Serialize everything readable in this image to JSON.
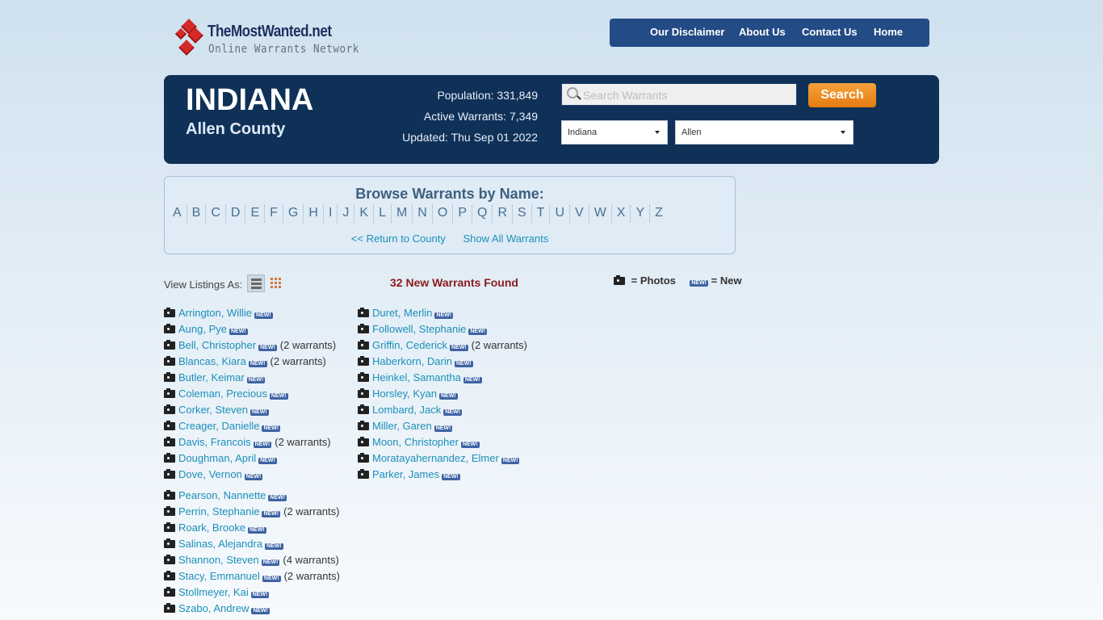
{
  "logo": {
    "title": "TheMostWanted.net",
    "tagline": "Online Warrants Network"
  },
  "nav": {
    "items": [
      "Our Disclaimer",
      "About Us",
      "Contact Us",
      "Home"
    ]
  },
  "banner": {
    "state": "INDIANA",
    "county": "Allen County",
    "population": "Population: 331,849",
    "active_warrants": "Active Warrants: 7,349",
    "updated": "Updated: Thu Sep 01 2022",
    "search_placeholder": "Search Warrants",
    "search_value": "",
    "search_button": "Search",
    "state_select": "Indiana",
    "county_select": "Allen"
  },
  "browse": {
    "title": "Browse Warrants by Name:",
    "letters": [
      "A",
      "B",
      "C",
      "D",
      "E",
      "F",
      "G",
      "H",
      "I",
      "J",
      "K",
      "L",
      "M",
      "N",
      "O",
      "P",
      "Q",
      "R",
      "S",
      "T",
      "U",
      "V",
      "W",
      "X",
      "Y",
      "Z"
    ],
    "return_link": "<< Return to County",
    "show_all_link": "Show All Warrants"
  },
  "listing": {
    "view_as_label": "View Listings As:",
    "found_text": "32 New Warrants Found",
    "legend_photos": "= Photos",
    "legend_new": "= New",
    "new_badge": "NEW!",
    "icons": {
      "photo": "camera-icon",
      "new": "new-badge-icon",
      "list_view": "list-view-icon",
      "grid_view": "grid-view-icon"
    }
  },
  "warrants": {
    "col1a": [
      {
        "name": "Arrington, Willie",
        "count": ""
      },
      {
        "name": "Aung, Pye",
        "count": ""
      },
      {
        "name": "Bell, Christopher",
        "count": "(2 warrants)"
      },
      {
        "name": "Blancas, Kiara",
        "count": "(2 warrants)"
      },
      {
        "name": "Butler, Keimar",
        "count": ""
      },
      {
        "name": "Coleman, Precious",
        "count": ""
      },
      {
        "name": "Corker, Steven",
        "count": ""
      },
      {
        "name": "Creager, Danielle",
        "count": ""
      },
      {
        "name": "Davis, Francois",
        "count": "(2 warrants)"
      },
      {
        "name": "Doughman, April",
        "count": ""
      },
      {
        "name": "Dove, Vernon",
        "count": ""
      }
    ],
    "col2": [
      {
        "name": "Duret, Merlin",
        "count": ""
      },
      {
        "name": "Followell, Stephanie",
        "count": ""
      },
      {
        "name": "Griffin, Cederick",
        "count": "(2 warrants)"
      },
      {
        "name": "Haberkorn, Darin",
        "count": ""
      },
      {
        "name": "Heinkel, Samantha",
        "count": ""
      },
      {
        "name": "Horsley, Kyan",
        "count": ""
      },
      {
        "name": "Lombard, Jack",
        "count": ""
      },
      {
        "name": "Miller, Garen",
        "count": ""
      },
      {
        "name": "Moon, Christopher",
        "count": ""
      },
      {
        "name": "Moratayahernandez, Elmer",
        "count": ""
      },
      {
        "name": "Parker, James",
        "count": ""
      }
    ],
    "col1b": [
      {
        "name": "Pearson, Nannette",
        "count": ""
      },
      {
        "name": "Perrin, Stephanie",
        "count": "(2 warrants)"
      },
      {
        "name": "Roark, Brooke",
        "count": ""
      },
      {
        "name": "Salinas, Alejandra",
        "count": ""
      },
      {
        "name": "Shannon, Steven",
        "count": "(4 warrants)"
      },
      {
        "name": "Stacy, Emmanuel",
        "count": "(2 warrants)"
      },
      {
        "name": "Stollmeyer, Kai",
        "count": ""
      },
      {
        "name": "Szabo, Andrew",
        "count": ""
      }
    ]
  }
}
